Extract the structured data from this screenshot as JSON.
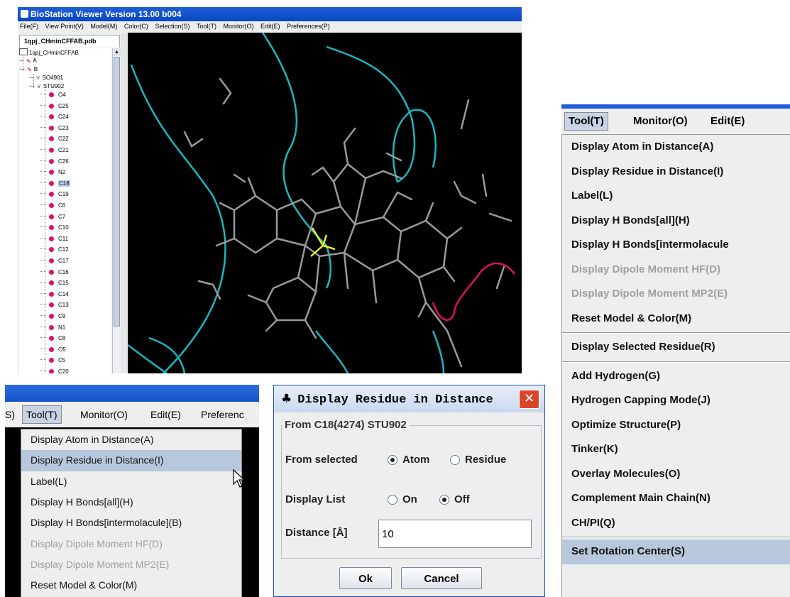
{
  "main_window": {
    "title": "BioStation Viewer Version 13.00 b004",
    "menu": [
      "File(F)",
      "View Point(V)",
      "Model(M)",
      "Color(C)",
      "Selection(S)",
      "Tool(T)",
      "Monitor(O)",
      "Edit(E)",
      "Preferences(P)"
    ],
    "file_tab": "1qpj_CHminCFFAB.pdb",
    "tree": {
      "root": "1qpj_CHminCFFAB",
      "chains": [
        "A",
        "B"
      ],
      "residues": [
        "SO4901",
        "STU902"
      ],
      "atoms": [
        "O4",
        "C25",
        "C24",
        "C23",
        "C22",
        "C21",
        "C26",
        "N2",
        "C18",
        "C19",
        "C6",
        "C7",
        "C10",
        "C11",
        "C12",
        "C17",
        "C16",
        "C15",
        "C14",
        "C13",
        "C9",
        "N1",
        "C8",
        "O5",
        "C5",
        "C20"
      ],
      "selected_atom": "C18"
    }
  },
  "right_menu": {
    "header": [
      "Tool(T)",
      "Monitor(O)",
      "Edit(E)"
    ],
    "items": [
      {
        "label": "Display Atom in Distance(A)",
        "state": "enabled"
      },
      {
        "label": "Display Residue in Distance(I)",
        "state": "enabled"
      },
      {
        "label": "Label(L)",
        "state": "enabled"
      },
      {
        "label": "Display H Bonds[all](H)",
        "state": "enabled"
      },
      {
        "label": "Display H Bonds[intermolacule",
        "state": "enabled"
      },
      {
        "label": "Display Dipole Moment HF(D)",
        "state": "disabled"
      },
      {
        "label": "Display Dipole Moment MP2(E)",
        "state": "disabled"
      },
      {
        "label": "Reset Model & Color(M)",
        "state": "enabled"
      },
      {
        "label": "Display Selected Residue(R)",
        "state": "enabled"
      },
      {
        "label": "Add Hydrogen(G)",
        "state": "enabled"
      },
      {
        "label": "Hydrogen Capping Mode(J)",
        "state": "enabled"
      },
      {
        "label": "Optimize Structure(P)",
        "state": "enabled"
      },
      {
        "label": "Tinker(K)",
        "state": "enabled"
      },
      {
        "label": "Overlay Molecules(O)",
        "state": "enabled"
      },
      {
        "label": "Complement Main Chain(N)",
        "state": "enabled"
      },
      {
        "label": "CH/PI(Q)",
        "state": "enabled"
      },
      {
        "label": "Set Rotation Center(S)",
        "state": "highlighted"
      }
    ]
  },
  "bottom_menu": {
    "header": [
      "S)",
      "Tool(T)",
      "Monitor(O)",
      "Edit(E)",
      "Preferenc"
    ],
    "items": [
      {
        "label": "Display Atom in Distance(A)",
        "state": "enabled"
      },
      {
        "label": "Display Residue in Distance(I)",
        "state": "highlighted"
      },
      {
        "label": "Label(L)",
        "state": "enabled"
      },
      {
        "label": "Display H Bonds[all](H)",
        "state": "enabled"
      },
      {
        "label": "Display H Bonds[intermolacule](B)",
        "state": "enabled"
      },
      {
        "label": "Display Dipole Moment HF(D)",
        "state": "disabled"
      },
      {
        "label": "Display Dipole Moment MP2(E)",
        "state": "disabled"
      },
      {
        "label": "Reset Model & Color(M)",
        "state": "enabled"
      }
    ]
  },
  "dialog": {
    "title": "Display Residue in Distance",
    "group_title": "From C18(4274) STU902",
    "from_selected_label": "From selected",
    "from_options": [
      "Atom",
      "Residue"
    ],
    "from_selected": "Atom",
    "display_list_label": "Display List",
    "display_list_options": [
      "On",
      "Off"
    ],
    "display_list_selected": "Off",
    "distance_label": "Distance [Å]",
    "distance_value": "10",
    "ok_label": "Ok",
    "cancel_label": "Cancel",
    "close_glyph": "✕"
  },
  "colors": {
    "titlebar_blue": "#0a46c4",
    "viewer_bg": "#000000",
    "chain_cyan": "#19b8c0",
    "chain_magenta": "#e0105e",
    "bond_gray": "#9a9a9a",
    "selected_yellow": "#f0f020",
    "atom_dot": "#e0106a",
    "menu_highlight": "#b8c8dc",
    "close_red": "#d8462a"
  }
}
